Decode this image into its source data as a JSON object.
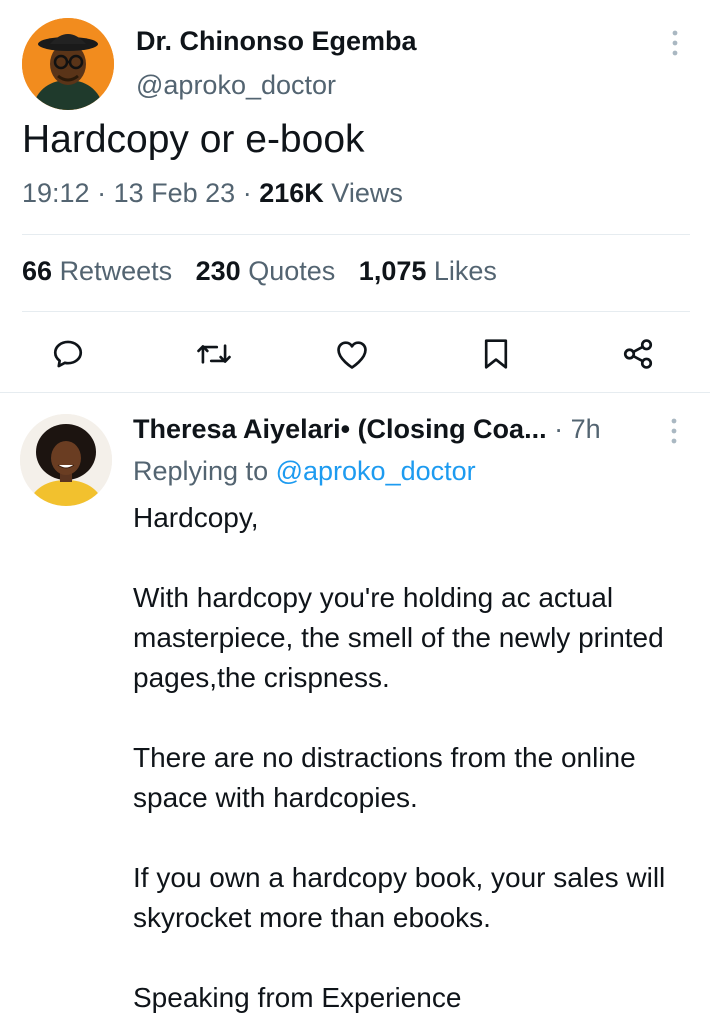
{
  "tweet": {
    "author_name": "Dr. Chinonso Egemba",
    "author_handle": "@aproko_doctor",
    "text": "Hardcopy or e-book",
    "time": "19:12",
    "date": "13 Feb 23",
    "views_count": "216K",
    "views_label": "Views",
    "separator": "·"
  },
  "stats": {
    "retweets_count": "66",
    "retweets_label": "Retweets",
    "quotes_count": "230",
    "quotes_label": "Quotes",
    "likes_count": "1,075",
    "likes_label": "Likes"
  },
  "actions": [
    "reply-icon",
    "retweet-icon",
    "like-icon",
    "bookmark-icon",
    "share-icon"
  ],
  "reply": {
    "author_name": "Theresa Aiyelari• (Closing Coa...",
    "separator": "·",
    "time": "7h",
    "replying_prefix": "Replying to",
    "replying_handle": "@aproko_doctor",
    "paragraphs": [
      "Hardcopy,",
      "With hardcopy you're holding ac actual masterpiece, the smell of the newly printed pages,the crispness.",
      "There are no distractions from the online space with hardcopies.",
      "If you own a hardcopy book, your sales will skyrocket more than ebooks.",
      "Speaking from Experience"
    ]
  },
  "colors": {
    "accent": "#1d9bf0",
    "text": "#0f1419",
    "secondary": "#536471",
    "divider": "#e6ecf0",
    "avatar1_bg": "#f28c1e",
    "avatar2_bg": "#f2c12e"
  }
}
